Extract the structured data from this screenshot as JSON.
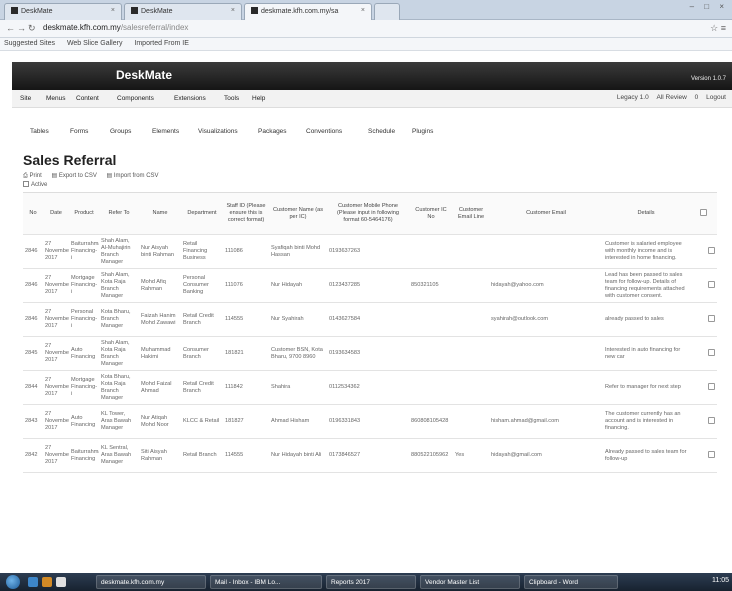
{
  "browser": {
    "tabs": [
      {
        "title": "DeskMate"
      },
      {
        "title": "DeskMate"
      },
      {
        "title": "deskmate.kfh.com.my/sa"
      }
    ],
    "url_host": "deskmate.kfh.com.my",
    "url_path": "/salesreferral/index",
    "bookmarks": [
      "Suggested Sites",
      "Web Slice Gallery",
      "Imported From IE"
    ]
  },
  "app": {
    "brand": "DeskMate",
    "version": "Version 1.0.7",
    "menu": [
      "Site",
      "Menus",
      "Content",
      "Components",
      "Extensions",
      "Tools",
      "Help"
    ],
    "util": [
      "Legacy 1.0",
      "All Review",
      "0",
      "Logout"
    ],
    "subtabs": [
      "Tables",
      "Forms",
      "Groups",
      "Elements",
      "Visualizations",
      "Packages",
      "Conventions",
      "Schedule",
      "Plugins"
    ]
  },
  "page": {
    "title": "Sales Referral",
    "toolbar": [
      "Print",
      "Export to CSV",
      "Import from CSV"
    ],
    "filter_label": "Active"
  },
  "table": {
    "headers": [
      "No",
      "Date",
      "Product",
      "Refer To",
      "Name",
      "Department",
      "Staff ID (Please ensure this is correct format)",
      "Customer Name (as per IC)",
      "Customer Mobile Phone (Please input in following format 60-5464176)",
      "Customer IC No",
      "Customer Email Line",
      "Customer Email",
      "Details"
    ],
    "rows": [
      [
        "2846",
        "27 November 2017",
        "Baiturrahman Financing-i",
        "Shah Alam, Al-Muhajirin Branch Manager",
        "Nur Aisyah binti Rahman",
        "Retail Financing Business",
        "111086",
        "Syafiqah binti Mohd Hassan",
        "0193637263",
        "",
        "",
        "",
        "Customer is salaried employee with monthly income and is interested in home financing."
      ],
      [
        "2846",
        "27 November 2017",
        "Mortgage Financing-i",
        "Shah Alam, Kota Raja Branch Manager",
        "Mohd Afiq Rahman",
        "Personal Consumer Banking",
        "111076",
        "Nur Hidayah",
        "0123437285",
        "850321105",
        "",
        "hidayah@yahoo.com",
        "Lead has been passed to sales team for follow-up. Details of financing requirements attached with customer consent."
      ],
      [
        "2846",
        "27 November 2017",
        "Personal Financing-i",
        "Kota Bharu, Branch Manager",
        "Faizah Hanim Mohd Zawawi",
        "Retail Credit Branch",
        "114555",
        "Nur Syahirah",
        "0143627584",
        "",
        "",
        "syahirah@outlook.com",
        "already passed to sales"
      ],
      [
        "2845",
        "27 November 2017",
        "Auto Financing",
        "Shah Alam, Kota Raja Branch Manager",
        "Muhammad Hakimi",
        "Consumer Branch",
        "181821",
        "Customer BSN, Kota Bharu, 9700 8960",
        "0193634583",
        "",
        "",
        "",
        "Interested in auto financing for new car"
      ],
      [
        "2844",
        "27 November 2017",
        "Mortgage Financing-i",
        "Kota Bharu, Kota Raja Branch Manager",
        "Mohd Faizal Ahmad",
        "Retail Credit Branch",
        "111842",
        "Shahira",
        "0112534362",
        "",
        "",
        "",
        "Refer to manager for next step"
      ],
      [
        "2843",
        "27 November 2017",
        "Auto Financing",
        "KL Tower, Aras Bawah Manager",
        "Nur Atiqah Mohd Noor",
        "KLCC & Retail",
        "181827",
        "Ahmad Hisham",
        "0196331843",
        "860808105428",
        "",
        "hisham.ahmad@gmail.com",
        "The customer currently has an account and is interested in financing."
      ],
      [
        "2842",
        "27 November 2017",
        "Baiturrahman Financing",
        "KL Sentral, Aras Bawah Manager",
        "Siti Aisyah Rahman",
        "Retail Branch",
        "114555",
        "Nur Hidayah binti Ali",
        "0173846527",
        "880522105962",
        "Yes",
        "hidayah@gmail.com",
        "Already passed to sales team for follow-up"
      ]
    ]
  },
  "taskbar": {
    "items": [
      "deskmate.kfh.com.my",
      "Mail - Inbox - IBM Lo...",
      "Reports 2017",
      "Vendor Master List",
      "Clipboard - Word"
    ],
    "clock": "11:05"
  },
  "colors": {
    "header_bg": "#1e1e1e",
    "brand_text": "#ffffff",
    "taskbar_bg": "#1c2a3a"
  }
}
